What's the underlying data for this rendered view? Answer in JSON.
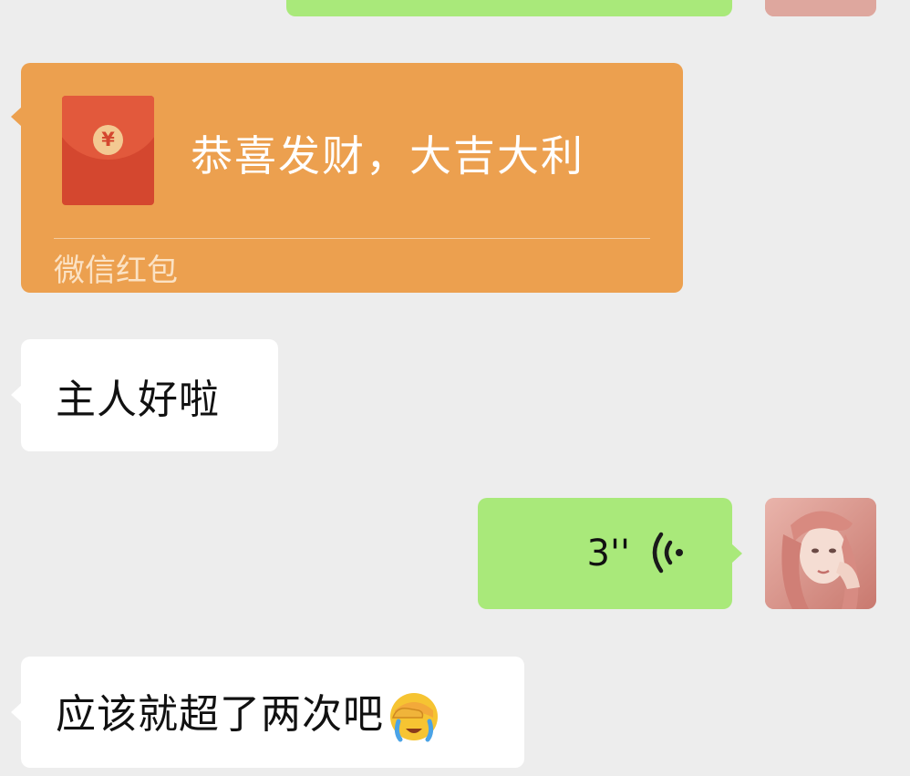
{
  "messages": {
    "red_packet": {
      "title": "恭喜发财，大吉大利",
      "footer": "微信红包",
      "currency_symbol": "¥",
      "color": "#eca04f"
    },
    "reply_1": {
      "text": "主人好啦"
    },
    "voice": {
      "duration": "3''",
      "icon": "voice-wave-icon"
    },
    "reply_2": {
      "text": "应该就超了两次吧",
      "emoji": "crying-facepalm-emoji"
    }
  },
  "colors": {
    "background": "#ededed",
    "outgoing_bubble": "#a9e97a",
    "incoming_bubble": "#ffffff"
  }
}
